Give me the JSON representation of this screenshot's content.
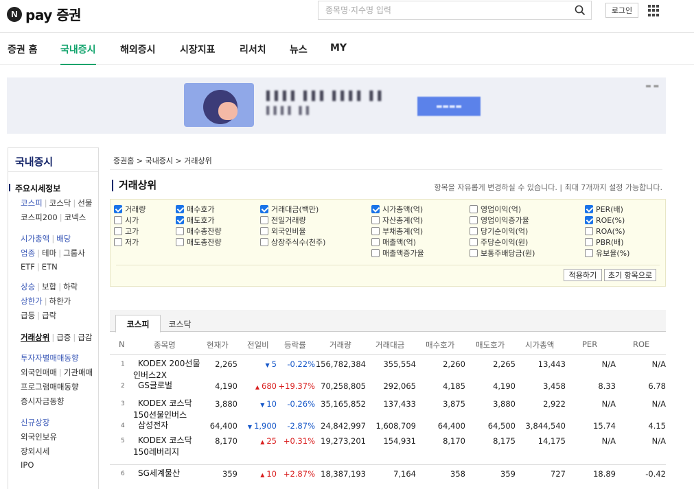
{
  "header": {
    "logo_letter": "N",
    "logo_text": "pay 증권",
    "search_placeholder": "종목명·지수명 입력",
    "login_label": "로그인"
  },
  "nav": [
    "증권 홈",
    "국내증시",
    "해외증시",
    "시장지표",
    "리서치",
    "뉴스",
    "MY"
  ],
  "nav_active": "국내증시",
  "sidebar": {
    "title": "국내증시",
    "head": "주요시세정보",
    "rows": [
      [
        [
          "코스피",
          "blue"
        ],
        [
          "코스닥",
          ""
        ],
        [
          "선물",
          ""
        ]
      ],
      [
        [
          "코스피200",
          ""
        ],
        [
          "코넥스",
          ""
        ]
      ],
      [
        [
          "시가총액",
          "blue"
        ],
        [
          "배당",
          "blue"
        ]
      ],
      [
        [
          "업종",
          "blue"
        ],
        [
          "테마",
          ""
        ],
        [
          "그룹사",
          ""
        ]
      ],
      [
        [
          "ETF",
          ""
        ],
        [
          "ETN",
          ""
        ]
      ],
      [
        [
          "상승",
          "blue"
        ],
        [
          "보합",
          ""
        ],
        [
          "하락",
          ""
        ]
      ],
      [
        [
          "상한가",
          "blue"
        ],
        [
          "하한가",
          ""
        ]
      ],
      [
        [
          "급등",
          ""
        ],
        [
          "급락",
          ""
        ]
      ],
      [
        [
          "거래상위",
          "cur"
        ],
        [
          "급증",
          ""
        ],
        [
          "급감",
          ""
        ]
      ],
      [
        [
          "투자자별매매동향",
          "blue"
        ]
      ],
      [
        [
          "외국인매매",
          ""
        ],
        [
          "기관매매",
          ""
        ]
      ],
      [
        [
          "프로그램매매동향",
          ""
        ]
      ],
      [
        [
          "증시자금동향",
          ""
        ]
      ],
      [
        [
          "신규상장",
          "blue"
        ]
      ],
      [
        [
          "외국인보유",
          ""
        ]
      ],
      [
        [
          "장외시세",
          ""
        ]
      ],
      [
        [
          "IPO",
          ""
        ]
      ]
    ]
  },
  "breadcrumb": "증권홈 > 국내증시 > 거래상위",
  "page_title": "거래상위",
  "page_note": "항목을 자유롭게 변경하실 수 있습니다.  |  최대 7개까지 설정 가능합니다.",
  "options": [
    [
      {
        "label": "거래량",
        "checked": true
      },
      {
        "label": "시가",
        "checked": false
      },
      {
        "label": "고가",
        "checked": false
      },
      {
        "label": "저가",
        "checked": false
      }
    ],
    [
      {
        "label": "매수호가",
        "checked": true
      },
      {
        "label": "매도호가",
        "checked": true
      },
      {
        "label": "매수총잔량",
        "checked": false
      },
      {
        "label": "매도총잔량",
        "checked": false
      }
    ],
    [
      {
        "label": "거래대금(백만)",
        "checked": true
      },
      {
        "label": "전일거래량",
        "checked": false
      },
      {
        "label": "외국인비율",
        "checked": false
      },
      {
        "label": "상장주식수(천주)",
        "checked": false
      }
    ],
    [
      {
        "label": "시가총액(억)",
        "checked": true
      },
      {
        "label": "자산총계(억)",
        "checked": false
      },
      {
        "label": "부채총계(억)",
        "checked": false
      },
      {
        "label": "매출액(억)",
        "checked": false
      },
      {
        "label": "매출액증가율",
        "checked": false
      }
    ],
    [
      {
        "label": "영업이익(억)",
        "checked": false
      },
      {
        "label": "영업이익증가율",
        "checked": false
      },
      {
        "label": "당기순이익(억)",
        "checked": false
      },
      {
        "label": "주당순이익(원)",
        "checked": false
      },
      {
        "label": "보통주배당금(원)",
        "checked": false
      }
    ],
    [
      {
        "label": "PER(배)",
        "checked": true
      },
      {
        "label": "ROE(%)",
        "checked": true
      },
      {
        "label": "ROA(%)",
        "checked": false
      },
      {
        "label": "PBR(배)",
        "checked": false
      },
      {
        "label": "유보율(%)",
        "checked": false
      }
    ]
  ],
  "option_buttons": [
    "적용하기",
    "초기 항목으로"
  ],
  "tabs": [
    "코스피",
    "코스닥"
  ],
  "table": {
    "headers": [
      "N",
      "종목명",
      "현재가",
      "전일비",
      "등락률",
      "거래량",
      "거래대금",
      "매수호가",
      "매도호가",
      "시가총액",
      "PER",
      "ROE"
    ],
    "rows": [
      {
        "n": "1",
        "name": "KODEX 200선물인버스2X",
        "lines": [
          "KODEX 200선물",
          "인버스2X"
        ],
        "price": "2,265",
        "dir": "down",
        "change": "5",
        "rate": "-0.22%",
        "volume": "156,782,384",
        "amount": "355,554",
        "bid": "2,260",
        "ask": "2,265",
        "mcap": "13,443",
        "per": "N/A",
        "roe": "N/A"
      },
      {
        "n": "2",
        "name": "GS글로벌",
        "lines": [
          "GS글로벌"
        ],
        "price": "4,190",
        "dir": "up",
        "change": "680",
        "rate": "+19.37%",
        "volume": "70,258,805",
        "amount": "292,065",
        "bid": "4,185",
        "ask": "4,190",
        "mcap": "3,458",
        "per": "8.33",
        "roe": "6.78"
      },
      {
        "n": "3",
        "name": "KODEX 코스닥150선물인버스",
        "lines": [
          "KODEX 코스닥",
          "150선물인버스"
        ],
        "price": "3,880",
        "dir": "down",
        "change": "10",
        "rate": "-0.26%",
        "volume": "35,165,852",
        "amount": "137,433",
        "bid": "3,875",
        "ask": "3,880",
        "mcap": "2,922",
        "per": "N/A",
        "roe": "N/A"
      },
      {
        "n": "4",
        "name": "삼성전자",
        "lines": [
          "삼성전자"
        ],
        "price": "64,400",
        "dir": "down",
        "change": "1,900",
        "rate": "-2.87%",
        "volume": "24,842,997",
        "amount": "1,608,709",
        "bid": "64,400",
        "ask": "64,500",
        "mcap": "3,844,540",
        "per": "15.74",
        "roe": "4.15"
      },
      {
        "n": "5",
        "name": "KODEX 코스닥150레버리지",
        "lines": [
          "KODEX 코스닥",
          "150레버리지"
        ],
        "price": "8,170",
        "dir": "up",
        "change": "25",
        "rate": "+0.31%",
        "volume": "19,273,201",
        "amount": "154,931",
        "bid": "8,170",
        "ask": "8,175",
        "mcap": "14,175",
        "per": "N/A",
        "roe": "N/A"
      },
      {
        "n": "6",
        "name": "SG세계물산",
        "lines": [
          "SG세계물산"
        ],
        "price": "359",
        "dir": "up",
        "change": "10",
        "rate": "+2.87%",
        "volume": "18,387,193",
        "amount": "7,164",
        "bid": "358",
        "ask": "359",
        "mcap": "727",
        "per": "18.89",
        "roe": "-0.42"
      }
    ]
  },
  "colors": {
    "accent": "#0fa36b",
    "up": "#d91e1e",
    "down": "#1456c8",
    "checkbox": "#1a73e8"
  }
}
